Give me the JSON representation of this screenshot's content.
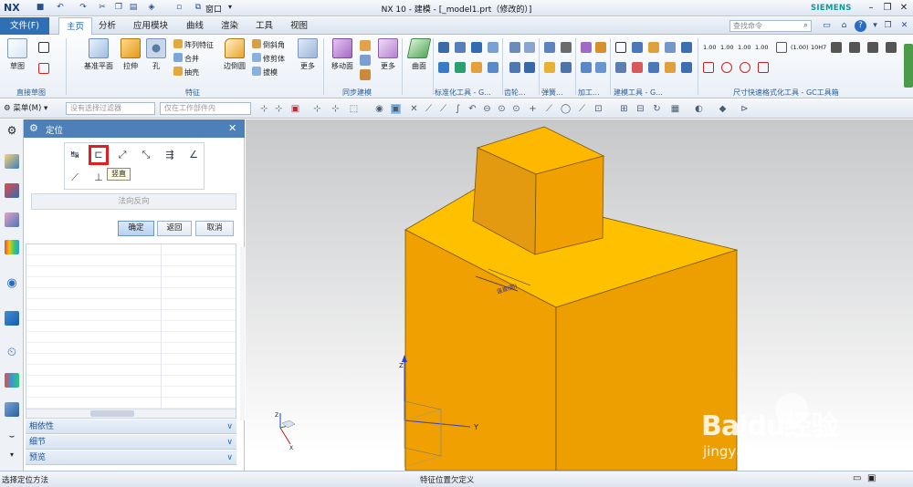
{
  "titlebar": {
    "logo": "NX",
    "title": "NX 10 - 建模 - [_model1.prt（修改的）]",
    "brand": "SIEMENS",
    "window_menu": "窗口"
  },
  "menubar": {
    "file": "文件(F)",
    "tabs": [
      "主页",
      "分析",
      "应用模块",
      "曲线",
      "渲染",
      "工具",
      "视图"
    ],
    "active_tab": "主页",
    "search_placeholder": "查找命令"
  },
  "ribbon": {
    "groups": [
      {
        "label": "直接草图",
        "items": [
          "草图"
        ]
      },
      {
        "label": "特征",
        "items": [
          "基准平面",
          "拉伸",
          "孔",
          "阵列特征",
          "合并",
          "抽壳",
          "边倒圆",
          "倒斜角",
          "修剪体",
          "拔模",
          "更多"
        ]
      },
      {
        "label": "同步建模",
        "items": [
          "移动面",
          "更多"
        ]
      },
      {
        "label": "",
        "items": [
          "曲面"
        ]
      },
      {
        "label": "标准化工具 - G...",
        "items": []
      },
      {
        "label": "齿轮...",
        "items": []
      },
      {
        "label": "弹簧...",
        "items": []
      },
      {
        "label": "加工...",
        "items": []
      },
      {
        "label": "建模工具 - G...",
        "items": []
      },
      {
        "label": "尺寸快速格式化工具 - GC工具箱",
        "items": []
      }
    ],
    "dim_buttons": [
      "1.00",
      "1.00",
      "1.00",
      "1.00",
      "(1.00)",
      "10H7"
    ]
  },
  "selbar": {
    "menu": "菜单(M)",
    "filter_placeholder": "没有选择过滤器",
    "scope_placeholder": "仅在工作部件内"
  },
  "dialog": {
    "title": "定位",
    "tooltip": "竖直",
    "reverse": "法向反向",
    "ok": "确定",
    "back": "返回",
    "cancel": "取消",
    "sections": [
      "相依性",
      "细节",
      "预览"
    ]
  },
  "status": {
    "left": "选择定位方法",
    "center": "特征位置欠定义"
  },
  "viewport": {
    "dimension_label": "竖直(图)",
    "axis_x": "X",
    "axis_y": "Y",
    "axis_z": "Z",
    "body_color": "#f0a000"
  },
  "watermark": {
    "brand": "Baidu经验",
    "url": "jingyan.baidu.com"
  }
}
